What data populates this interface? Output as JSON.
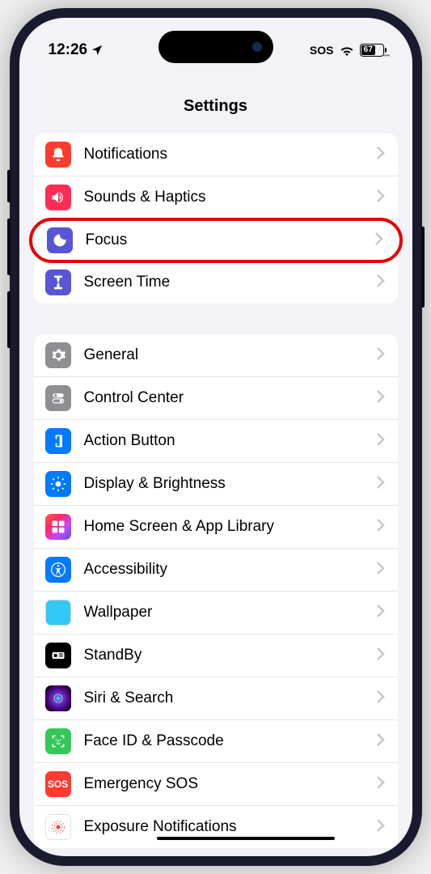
{
  "statusBar": {
    "time": "12:26",
    "sos": "SOS",
    "battery": "67"
  },
  "title": "Settings",
  "group1": [
    {
      "label": "Notifications"
    },
    {
      "label": "Sounds & Haptics"
    },
    {
      "label": "Focus"
    },
    {
      "label": "Screen Time"
    }
  ],
  "group2": [
    {
      "label": "General"
    },
    {
      "label": "Control Center"
    },
    {
      "label": "Action Button"
    },
    {
      "label": "Display & Brightness"
    },
    {
      "label": "Home Screen & App Library"
    },
    {
      "label": "Accessibility"
    },
    {
      "label": "Wallpaper"
    },
    {
      "label": "StandBy"
    },
    {
      "label": "Siri & Search"
    },
    {
      "label": "Face ID & Passcode"
    },
    {
      "label": "Emergency SOS"
    },
    {
      "label": "Exposure Notifications"
    }
  ]
}
